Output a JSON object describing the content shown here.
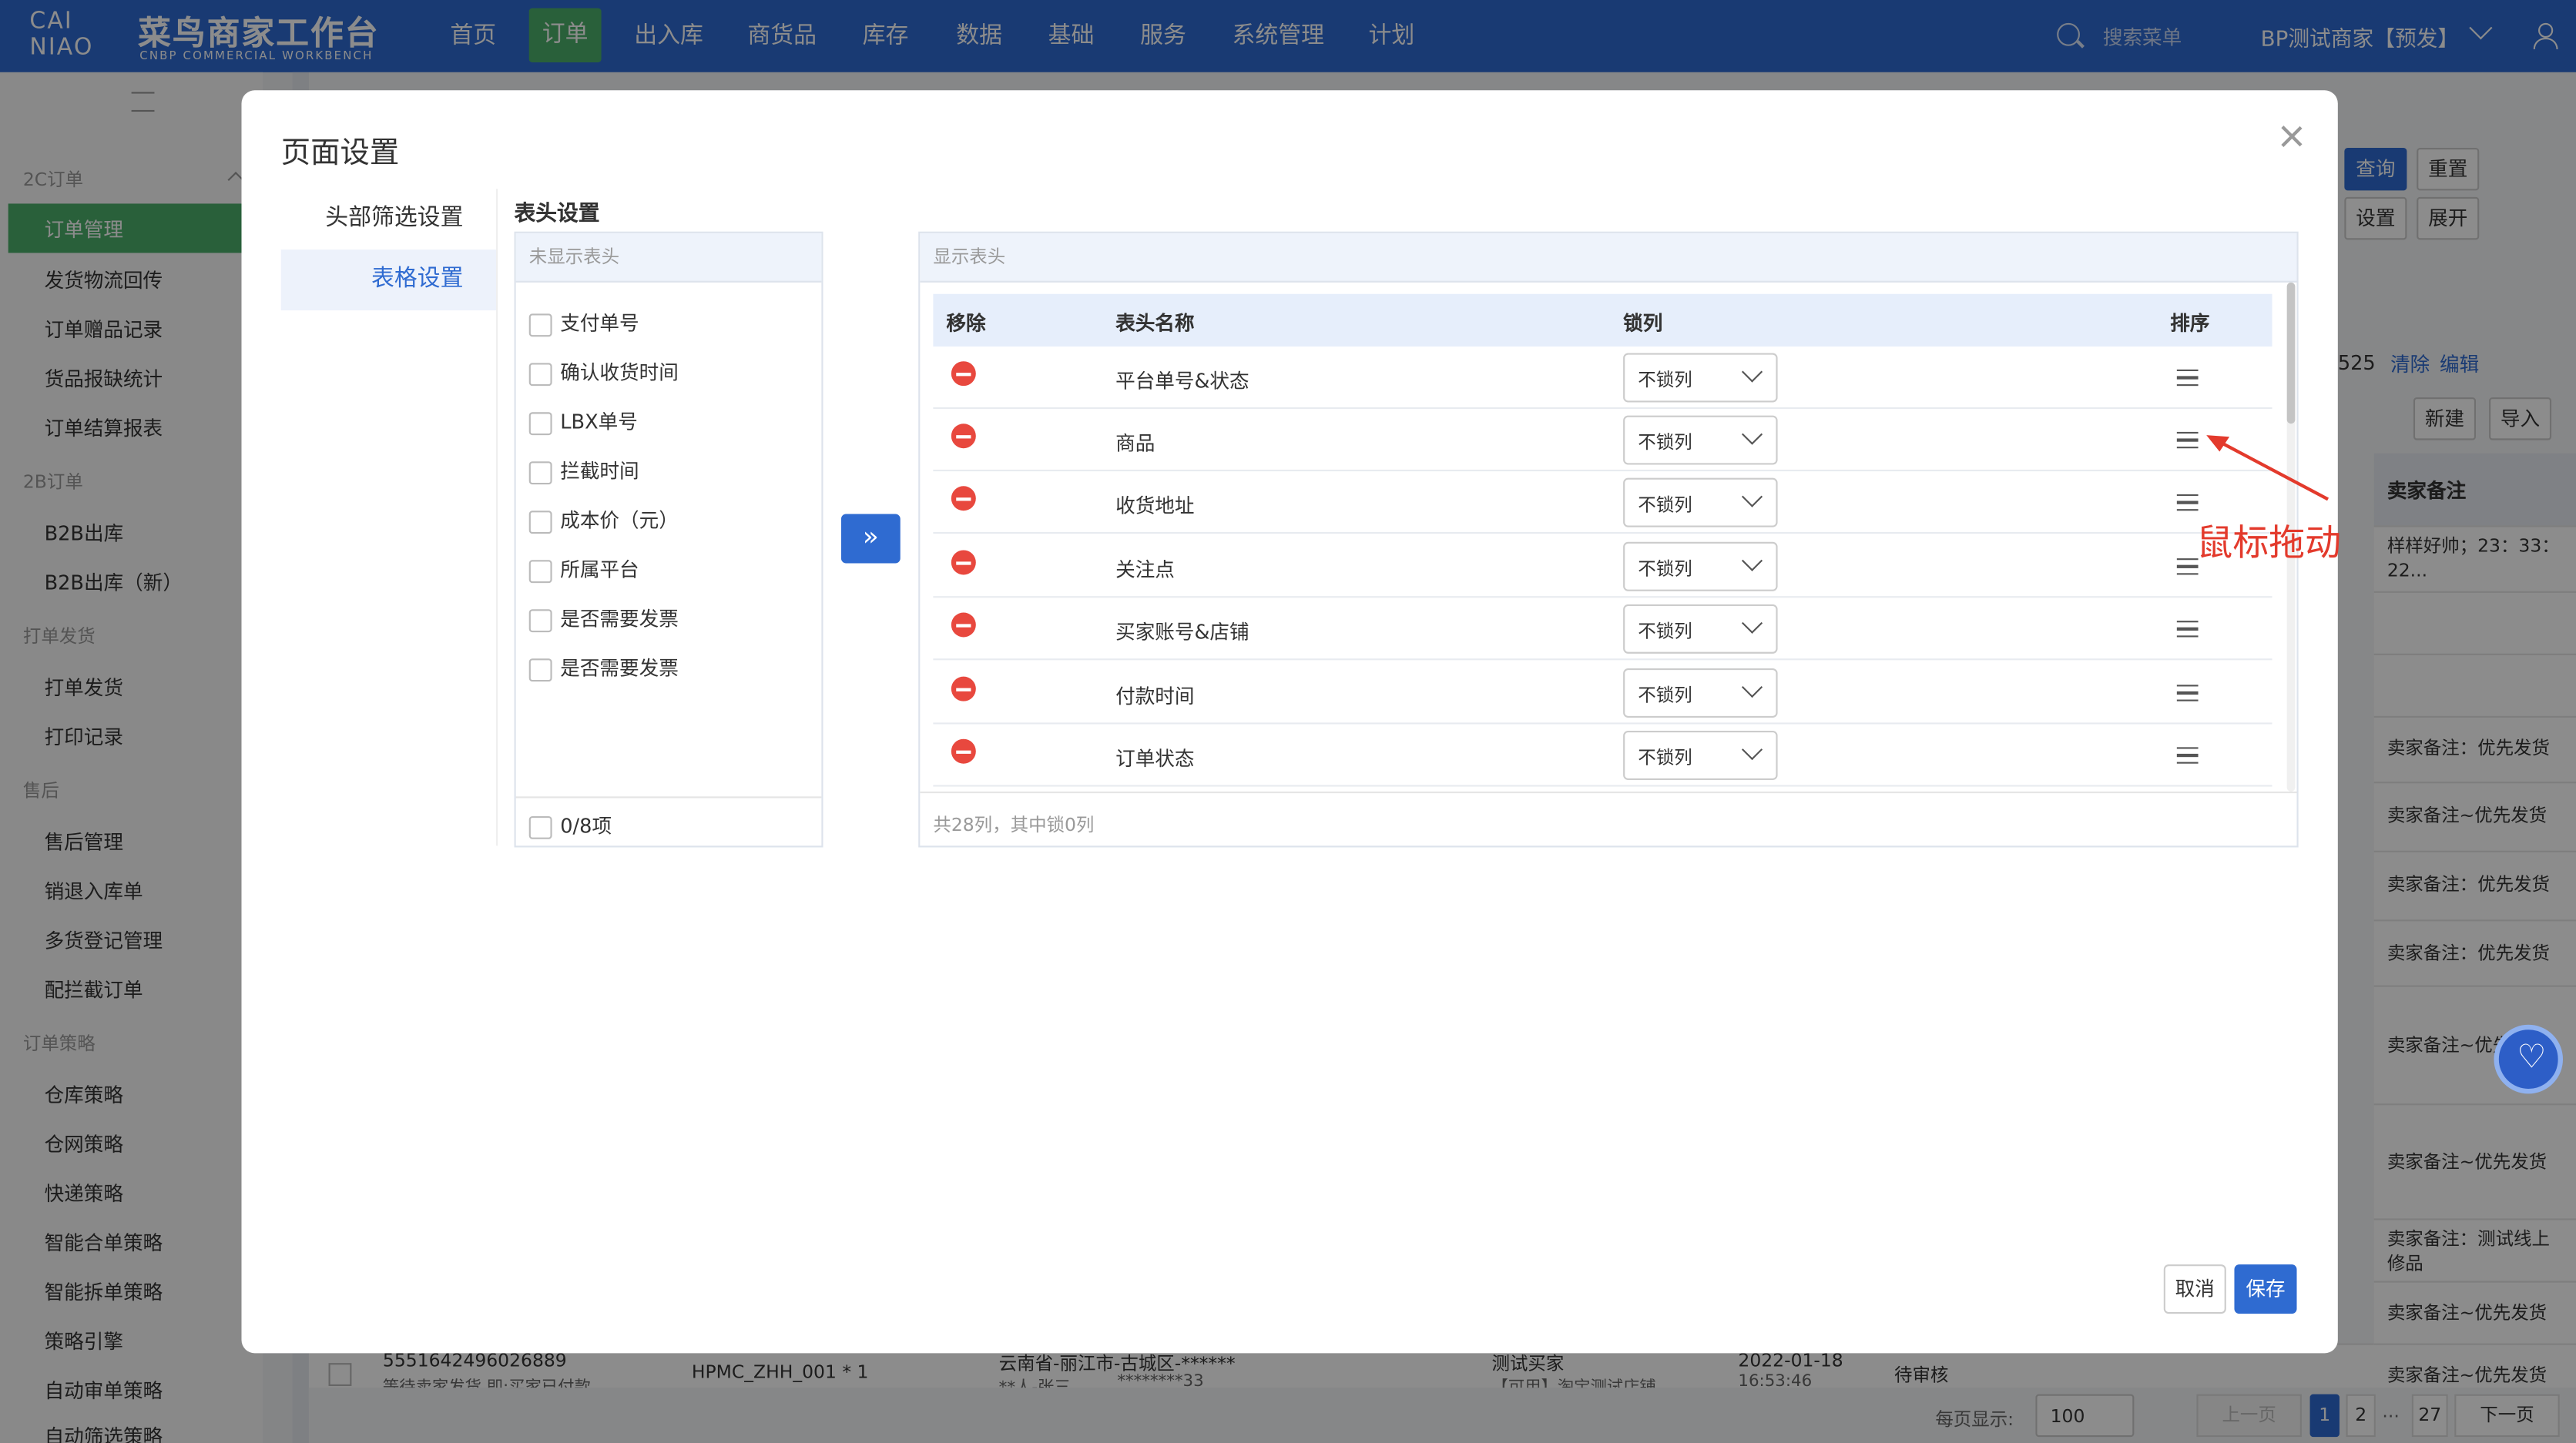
{
  "app": {
    "logo_text": "CAI NIAO",
    "brand": "菜鸟商家工作台",
    "brand_sub": "CNBP COMMERCIAL WORKBENCH"
  },
  "nav": [
    "首页",
    "订单",
    "出入库",
    "商货品",
    "库存",
    "数据",
    "基础",
    "服务",
    "系统管理",
    "计划"
  ],
  "header": {
    "search_placeholder": "搜索菜单",
    "merchant": "BP测试商家【预发】"
  },
  "sidebar": {
    "groups": [
      {
        "label": "2C订单",
        "items": [
          "订单管理",
          "发货物流回传",
          "订单赠品记录",
          "货品报缺统计",
          "订单结算报表"
        ]
      },
      {
        "label": "2B订单",
        "items": [
          "B2B出库",
          "B2B出库（新）"
        ]
      },
      {
        "label": "打单发货",
        "items": [
          "打单发货",
          "打印记录"
        ]
      },
      {
        "label": "售后",
        "items": [
          "售后管理",
          "销退入库单",
          "多货登记管理",
          "配拦截订单"
        ]
      },
      {
        "label": "订单策略",
        "items": [
          "仓库策略",
          "仓网策略",
          "快递策略",
          "智能合单策略",
          "智能拆单策略",
          "策略引擎",
          "自动审单策略",
          "自动筛选策略"
        ]
      }
    ]
  },
  "background": {
    "buttons": {
      "query": "查询",
      "reset": "重置",
      "settings": "设置",
      "expand": "展开",
      "new": "新建",
      "import": "导入",
      "clear": "清除",
      "edit": "编辑"
    },
    "count_fragment": "525",
    "col_header": "卖家备注",
    "cells": [
      "样样好帅；23：33：22...",
      "卖家备注：优先发货",
      "卖家备注~优先发货",
      "卖家备注：优先发货",
      "卖家备注：优先发货",
      "卖家备注~优先",
      "卖家备注~优先发货",
      "卖家备注：测试线上修品",
      "卖家备注~优先发货",
      "卖家备注~优先发货"
    ],
    "bottom_row": {
      "order_no": "5551642496026889",
      "order_sub": "等待卖家发货,即:买家已付款",
      "goods": "HPMC_ZHH_001 * 1",
      "address": "云南省-丽江市-古城区-******",
      "address_sub": "**人-张三",
      "masked_phone": "********33",
      "buyer": "测试买家",
      "shop": "【可用】淘宝测试店铺",
      "date": "2022-01-18",
      "time": "16:53:46",
      "status": "待审核"
    },
    "pagination": {
      "per_page_label": "每页显示:",
      "per_page": "100",
      "prev": "上一页",
      "pages": [
        "1",
        "2",
        "...",
        "27"
      ],
      "next": "下一页"
    }
  },
  "modal": {
    "title": "页面设置",
    "tabs": [
      "头部筛选设置",
      "表格设置"
    ],
    "section_title": "表头设置",
    "hidden_panel": {
      "title": "未显示表头",
      "items": [
        "支付单号",
        "确认收货时间",
        "LBX单号",
        "拦截时间",
        "成本价（元）",
        "所属平台",
        "是否需要发票",
        "是否需要发票"
      ],
      "footer": "0/8项"
    },
    "shown_panel": {
      "title": "显示表头",
      "columns": [
        "移除",
        "表头名称",
        "锁列",
        "排序"
      ],
      "rows": [
        {
          "name": "平台单号&状态",
          "lock": "不锁列"
        },
        {
          "name": "商品",
          "lock": "不锁列"
        },
        {
          "name": "收货地址",
          "lock": "不锁列"
        },
        {
          "name": "关注点",
          "lock": "不锁列"
        },
        {
          "name": "买家账号&店铺",
          "lock": "不锁列"
        },
        {
          "name": "付款时间",
          "lock": "不锁列"
        },
        {
          "name": "订单状态",
          "lock": "不锁列"
        }
      ],
      "footer": "共28列，其中锁0列"
    },
    "buttons": {
      "cancel": "取消",
      "save": "保存"
    }
  },
  "annotation": "鼠标拖动",
  "colors": {
    "primary": "#2f6bd1",
    "nav_active": "#4caf6a",
    "remove": "#e8483e",
    "annotation": "#e33a2c"
  }
}
